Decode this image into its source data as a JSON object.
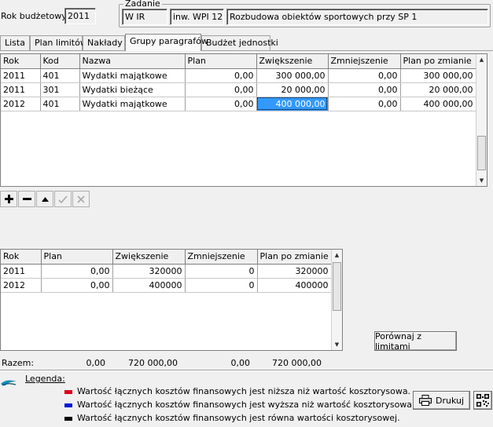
{
  "header": {
    "rok_label": "Rok budżetowy",
    "rok_value": "2011",
    "zadanie_label": "Zadanie",
    "zadanie_dept": "W IR",
    "zadanie_code": "inw. WPI 12",
    "zadanie_name": "Rozbudowa obiektów sportowych przy SP 1"
  },
  "tabs": [
    {
      "label": "Lista"
    },
    {
      "label": "Plan limitów"
    },
    {
      "label": "Nakłady"
    },
    {
      "label": "Grupy paragrafów"
    },
    {
      "label": "Budżet jednostki"
    }
  ],
  "top_grid": {
    "columns": [
      "Rok",
      "Kod",
      "Nazwa",
      "Plan",
      "Zwiększenie",
      "Zmniejszenie",
      "Plan po zmianie"
    ],
    "rows": [
      [
        "2011",
        "401",
        "Wydatki majątkowe",
        "0,00",
        "300 000,00",
        "0,00",
        "300 000,00"
      ],
      [
        "2011",
        "301",
        "Wydatki bieżące",
        "0,00",
        "20 000,00",
        "0,00",
        "20 000,00"
      ],
      [
        "2012",
        "401",
        "Wydatki majątkowe",
        "0,00",
        "400 000,00",
        "0,00",
        "400 000,00"
      ]
    ]
  },
  "bottom_grid": {
    "columns": [
      "Rok",
      "Plan",
      "Zwiększenie",
      "Zmniejszenie",
      "Plan po zmianie"
    ],
    "rows": [
      [
        "2011",
        "0,00",
        "320000",
        "0",
        "320000"
      ],
      [
        "2012",
        "0,00",
        "400000",
        "0",
        "400000"
      ]
    ]
  },
  "compare_button": "Porównaj z limitami",
  "totals": {
    "label": "Razem:",
    "plan": "0,00",
    "zwiekszenie": "720 000,00",
    "zmniejszenie": "0,00",
    "plan_po_zmianie": "720 000,00"
  },
  "legend": {
    "title": "Legenda:",
    "items": [
      {
        "color": "#e0001b",
        "text": "Wartość łącznych kosztów finansowych jest niższa niż wartość kosztorysowa."
      },
      {
        "color": "#0018d8",
        "text": "Wartość łącznych kosztów finansowych jest wyższa niż wartość kosztorysowa."
      },
      {
        "color": "#000000",
        "text": "Wartość łącznych kosztów finansowych jest równa wartości kosztorysowej."
      }
    ]
  },
  "print_button": "Drukuj",
  "icons": {
    "toolbar": [
      "plus-icon",
      "minus-icon",
      "up-arrow-icon",
      "check-icon",
      "cancel-icon"
    ],
    "print": "printer-icon",
    "qr": "qr-code-icon",
    "logo": "bird-logo-icon"
  }
}
